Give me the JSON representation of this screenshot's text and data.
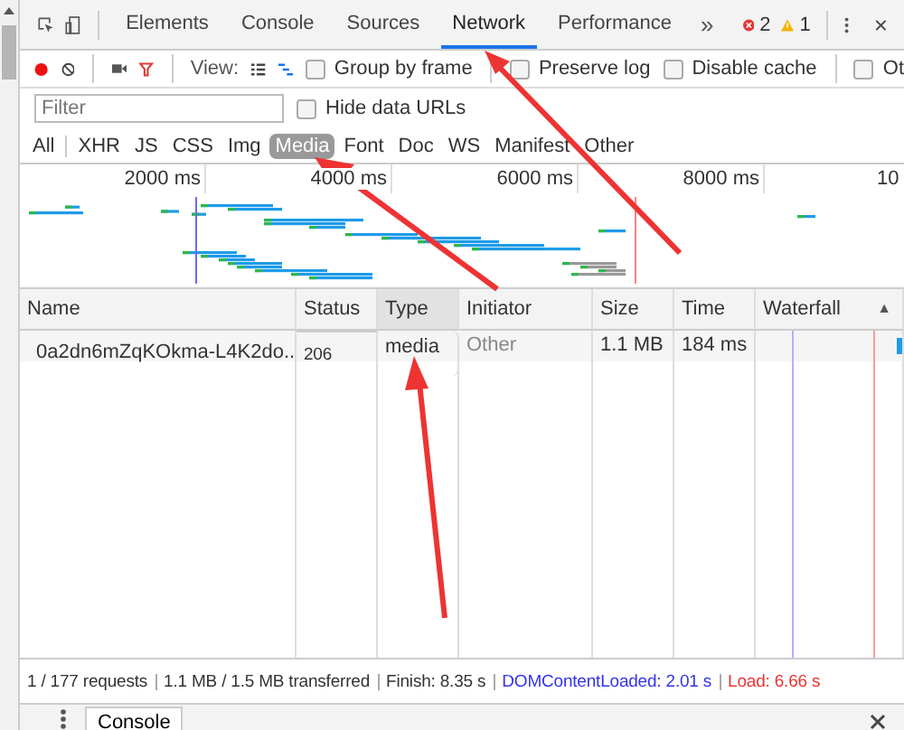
{
  "tabs": [
    {
      "label": "Elements",
      "selected": false
    },
    {
      "label": "Console",
      "selected": false
    },
    {
      "label": "Sources",
      "selected": false
    },
    {
      "label": "Network",
      "selected": true
    },
    {
      "label": "Performance",
      "selected": false
    }
  ],
  "more_tabs": "»",
  "errors": "2",
  "warnings": "1",
  "toolbar": {
    "recording": true,
    "view_label": "View:",
    "options": [
      {
        "label": "Group by frame",
        "checked": false
      },
      {
        "label": "Preserve log",
        "checked": false
      },
      {
        "label": "Disable cache",
        "checked": false
      },
      {
        "label": "Ot",
        "checked": false
      }
    ]
  },
  "filter": {
    "placeholder": "Filter",
    "hide_data_urls": {
      "label": "Hide data URLs",
      "checked": false
    }
  },
  "types": [
    {
      "label": "All",
      "selected": false
    },
    {
      "label": "XHR",
      "selected": false
    },
    {
      "label": "JS",
      "selected": false
    },
    {
      "label": "CSS",
      "selected": false
    },
    {
      "label": "Img",
      "selected": false
    },
    {
      "label": "Media",
      "selected": true
    },
    {
      "label": "Font",
      "selected": false
    },
    {
      "label": "Doc",
      "selected": false
    },
    {
      "label": "WS",
      "selected": false
    },
    {
      "label": "Manifest",
      "selected": false
    },
    {
      "label": "Other",
      "selected": false
    }
  ],
  "overview": {
    "ticks": [
      "2000 ms",
      "4000 ms",
      "6000 ms",
      "8000 ms",
      "10"
    ]
  },
  "table": {
    "columns": [
      {
        "label": "Name",
        "highlighted": false
      },
      {
        "label": "Status",
        "highlighted": false
      },
      {
        "label": "Type",
        "highlighted": true
      },
      {
        "label": "Initiator",
        "highlighted": false
      },
      {
        "label": "Size",
        "highlighted": false
      },
      {
        "label": "Time",
        "highlighted": false
      },
      {
        "label": "Waterfall",
        "highlighted": false,
        "sort_mark": "▲"
      }
    ],
    "rows": [
      {
        "name": "0a2dn6mZqKOkma-L4K2do...",
        "status": "206",
        "type": "media",
        "initiator": "Other",
        "size": "1.1 MB",
        "time": "184 ms"
      }
    ]
  },
  "status_bar": {
    "requests": "1 / 177 requests",
    "transferred": "1.1 MB / 1.5 MB transferred",
    "finish": "Finish: 8.35 s",
    "dom_content_loaded": "DOMContentLoaded: 2.01 s",
    "load": "Load: 6.66 s"
  },
  "drawer": {
    "tab": "Console"
  }
}
